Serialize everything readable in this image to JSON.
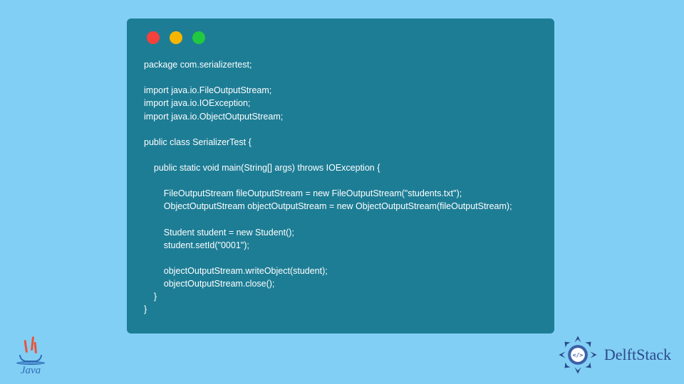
{
  "code": {
    "lines": [
      "package com.serializertest;",
      "",
      "import java.io.FileOutputStream;",
      "import java.io.IOException;",
      "import java.io.ObjectOutputStream;",
      "",
      "public class SerializerTest {",
      "",
      "    public static void main(String[] args) throws IOException {",
      "",
      "        FileOutputStream fileOutputStream = new FileOutputStream(\"students.txt\");",
      "        ObjectOutputStream objectOutputStream = new ObjectOutputStream(fileOutputStream);",
      "",
      "        Student student = new Student();",
      "        student.setId(\"0001\");",
      "",
      "        objectOutputStream.writeObject(student);",
      "        objectOutputStream.close();",
      "    }",
      "}"
    ]
  },
  "logos": {
    "java_label": "Java",
    "delft_label": "DelftStack"
  },
  "colors": {
    "background": "#82cff5",
    "window": "#1d7d95",
    "red": "#f5413b",
    "yellow": "#f7b500",
    "green": "#21c940",
    "java_blue": "#2e6db5",
    "java_orange": "#e8543b",
    "delft_blue": "#2a4a8a"
  }
}
